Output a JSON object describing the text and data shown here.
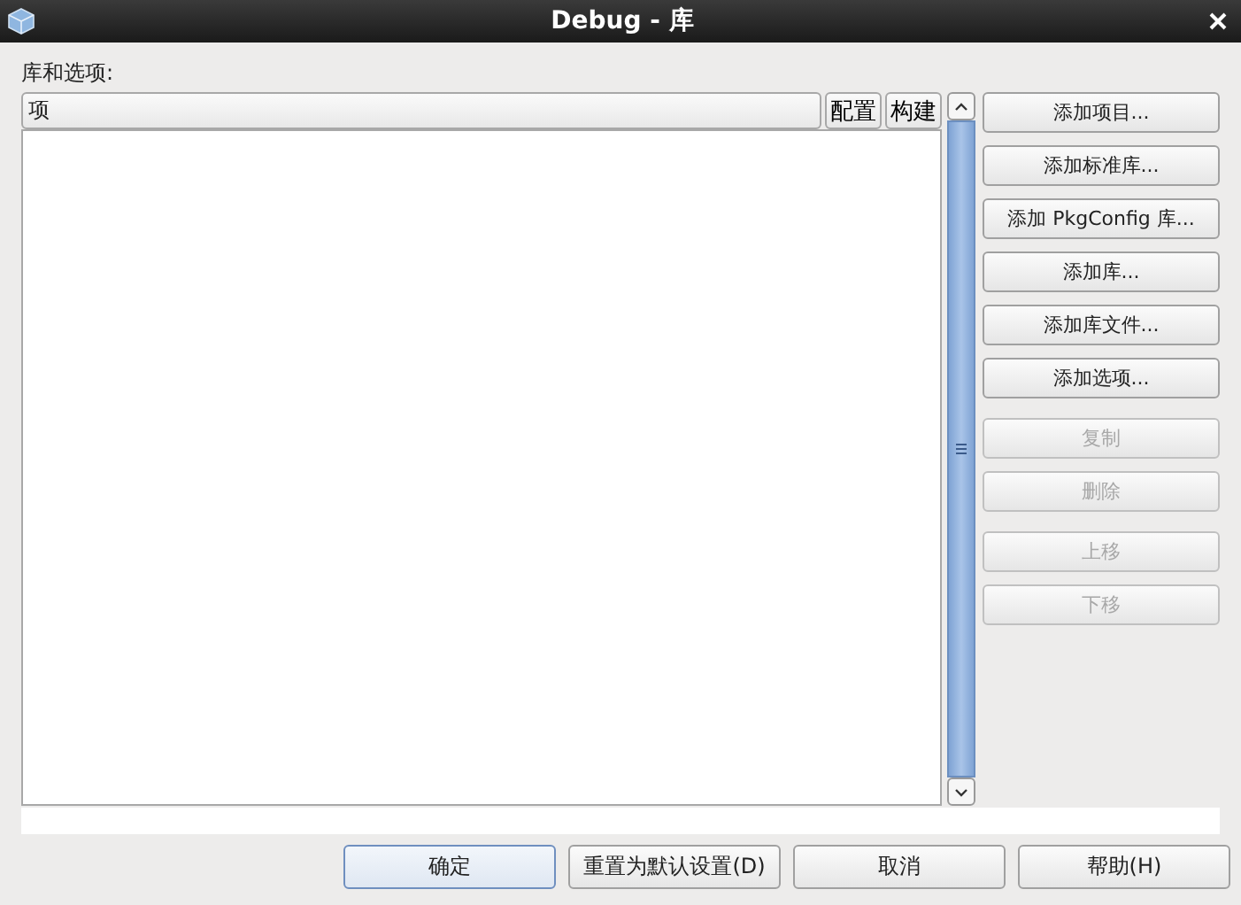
{
  "window": {
    "title": "Debug - 库"
  },
  "list_label": "库和选项:",
  "list": {
    "column_header": "项",
    "header_buttons": [
      "配置",
      "构建"
    ]
  },
  "side_button_groups": [
    [
      {
        "label": "添加项目...",
        "disabled": false
      },
      {
        "label": "添加标准库...",
        "disabled": false
      },
      {
        "label": "添加 PkgConfig 库...",
        "disabled": false
      },
      {
        "label": "添加库...",
        "disabled": false
      },
      {
        "label": "添加库文件...",
        "disabled": false
      },
      {
        "label": "添加选项...",
        "disabled": false
      }
    ],
    [
      {
        "label": "复制",
        "disabled": true
      },
      {
        "label": "删除",
        "disabled": true
      }
    ],
    [
      {
        "label": "上移",
        "disabled": true
      },
      {
        "label": "下移",
        "disabled": true
      }
    ]
  ],
  "footer_buttons": [
    {
      "label": "确定",
      "selected": true
    },
    {
      "label": "重置为默认设置(D)",
      "selected": false
    },
    {
      "label": "取消",
      "selected": false
    },
    {
      "label": "帮助(H)",
      "selected": false
    }
  ]
}
